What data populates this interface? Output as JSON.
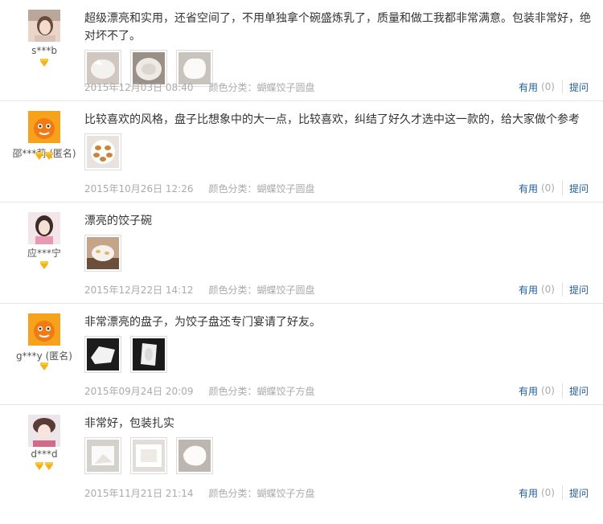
{
  "reviews": [
    {
      "user": "s***b",
      "avatar": "avatar-photo-icon",
      "badges": 1,
      "comment": "超级漂亮和实用，还省空间了，不用单独拿个碗盛炼乳了，质量和做工我都非常满意。包装非常好，绝对坏不了。",
      "photos": [
        "plate-photo-1",
        "plate-photo-2",
        "plate-photo-3"
      ],
      "date": "2015年12月03日 08:40",
      "spec": "颜色分类：蝴蝶饺子圆盘",
      "useful_label": "有用",
      "useful_count": "(0)",
      "ask_label": "提问"
    },
    {
      "user": "邵***莉 (匿名)",
      "avatar": "anonymous-mascot-icon",
      "badges": 2,
      "comment": "比较喜欢的风格，盘子比想象中的大一点，比较喜欢，纠结了好久才选中这一款的，给大家做个参考",
      "photos": [
        "plate-photo-1"
      ],
      "date": "2015年10月26日 12:26",
      "spec": "颜色分类：蝴蝶饺子圆盘",
      "useful_label": "有用",
      "useful_count": "(0)",
      "ask_label": "提问"
    },
    {
      "user": "应***宁",
      "avatar": "avatar-photo-icon",
      "badges": 1,
      "comment": "漂亮的饺子碗",
      "photos": [
        "plate-photo-1"
      ],
      "date": "2015年12月22日 14:12",
      "spec": "颜色分类：蝴蝶饺子圆盘",
      "useful_label": "有用",
      "useful_count": "(0)",
      "ask_label": "提问"
    },
    {
      "user": "g***y (匿名)",
      "avatar": "anonymous-mascot-icon",
      "badges": 1,
      "comment": "非常漂亮的盘子，为饺子盘还专门宴请了好友。",
      "photos": [
        "plate-photo-1",
        "plate-photo-2"
      ],
      "date": "2015年09月24日 20:09",
      "spec": "颜色分类：蝴蝶饺子方盘",
      "useful_label": "有用",
      "useful_count": "(0)",
      "ask_label": "提问"
    },
    {
      "user": "d***d",
      "avatar": "avatar-photo-icon",
      "badges": 2,
      "comment": "非常好，包装扎实",
      "photos": [
        "plate-photo-1",
        "plate-photo-2",
        "plate-photo-3"
      ],
      "date": "2015年11月21日 21:14",
      "spec": "颜色分类：蝴蝶饺子方盘",
      "useful_label": "有用",
      "useful_count": "(0)",
      "ask_label": "提问"
    }
  ],
  "colors": {
    "link": "#1f5c99",
    "meta_text": "#aaaaaa",
    "badge": "#f3b21a",
    "divider": "#e6e6e6"
  }
}
